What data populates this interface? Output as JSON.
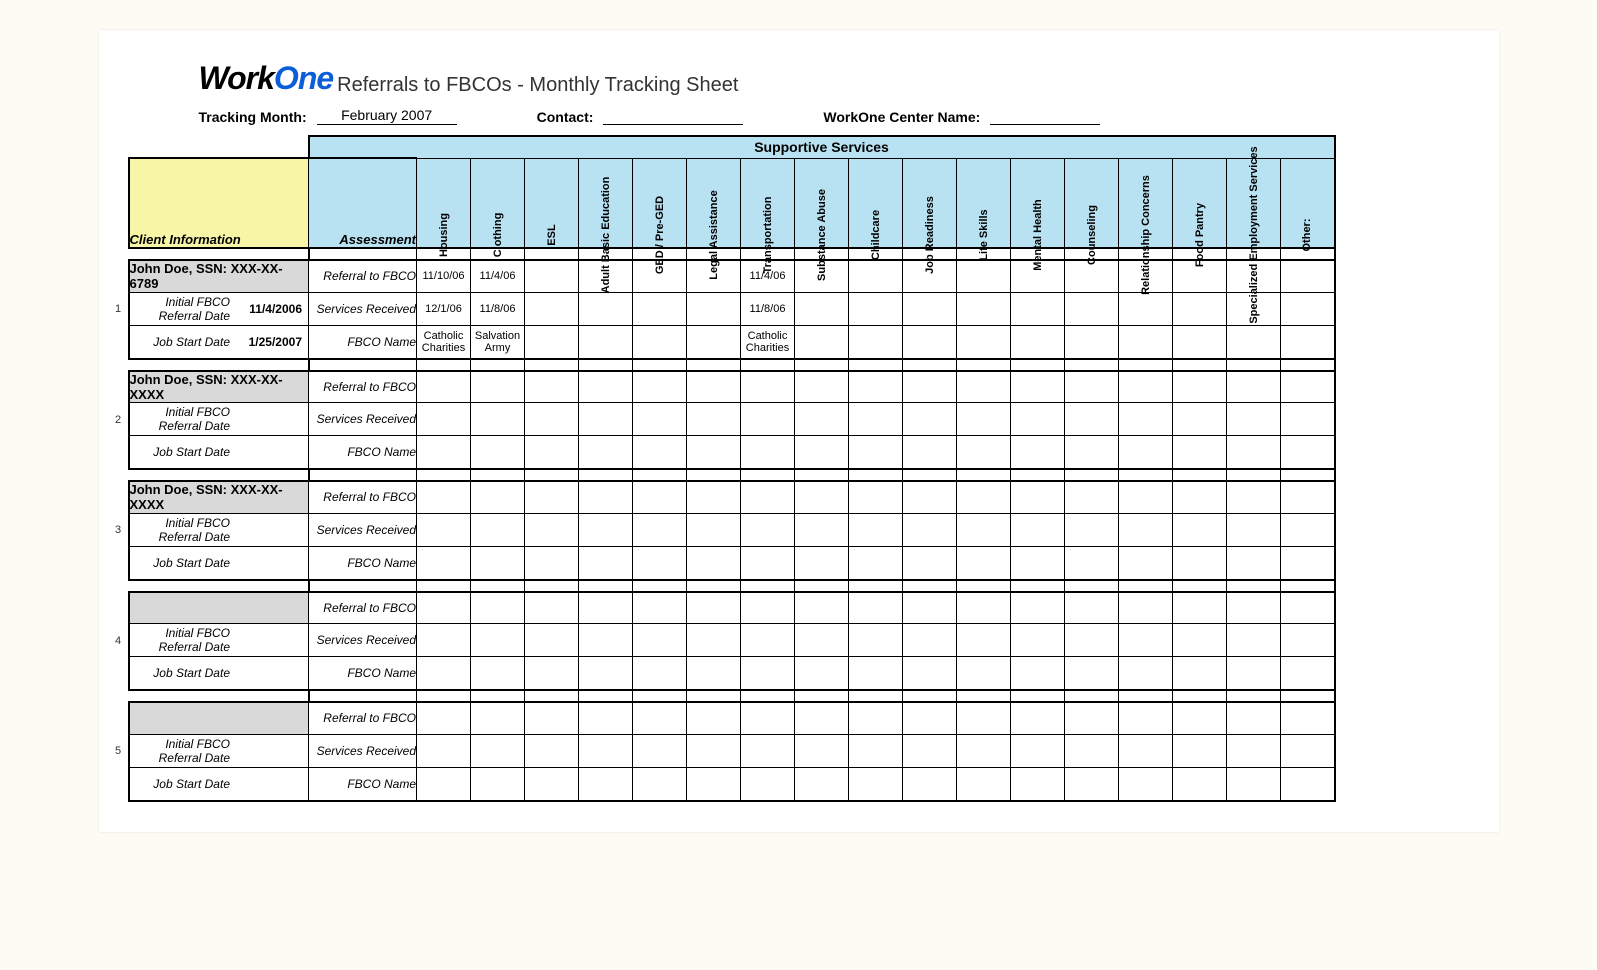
{
  "logo": {
    "part1": "Work",
    "part2": "One"
  },
  "title": "Referrals to FBCOs - Monthly Tracking Sheet",
  "meta": {
    "tracking_month_label": "Tracking Month:",
    "tracking_month_value": "February 2007",
    "contact_label": "Contact:",
    "contact_value": "",
    "center_label": "WorkOne Center Name:",
    "center_value": ""
  },
  "headers": {
    "supportive_services": "Supportive Services",
    "client_information": "Client Information",
    "assessment": "Assessment",
    "services": [
      "Housing",
      "Clothing",
      "ESL",
      "Adult Basic Education",
      "GED / Pre-GED",
      "Legal Assistance",
      "Transportation",
      "Substance Abuse",
      "Childcare",
      "Job Readiness",
      "Life Skills",
      "Mental Health",
      "Counseling",
      "Relationship Concerns",
      "Food Pantry",
      "Specialized Employment Services",
      "Other:"
    ]
  },
  "row_labels": {
    "referral": "Referral to FBCO",
    "received": "Services Received",
    "fbco": "FBCO Name",
    "initial": "Initial FBCO Referral Date",
    "jobstart": "Job Start Date"
  },
  "clients": [
    {
      "num": "1",
      "name": "John Doe, SSN: XXX-XX-6789",
      "initial_date": "11/4/2006",
      "jobstart_date": "1/25/2007",
      "rows": [
        {
          "cells": [
            "11/10/06",
            "11/4/06",
            "",
            "",
            "",
            "",
            "11/4/06",
            "",
            "",
            "",
            "",
            "",
            "",
            "",
            "",
            "",
            ""
          ]
        },
        {
          "cells": [
            "12/1/06",
            "11/8/06",
            "",
            "",
            "",
            "",
            "11/8/06",
            "",
            "",
            "",
            "",
            "",
            "",
            "",
            "",
            "",
            ""
          ]
        },
        {
          "cells": [
            "Catholic Charities",
            "Salvation Army",
            "",
            "",
            "",
            "",
            "Catholic Charities",
            "",
            "",
            "",
            "",
            "",
            "",
            "",
            "",
            "",
            ""
          ]
        }
      ]
    },
    {
      "num": "2",
      "name": "John Doe, SSN: XXX-XX-XXXX",
      "initial_date": "",
      "jobstart_date": "",
      "rows": [
        {
          "cells": [
            "",
            "",
            "",
            "",
            "",
            "",
            "",
            "",
            "",
            "",
            "",
            "",
            "",
            "",
            "",
            "",
            ""
          ]
        },
        {
          "cells": [
            "",
            "",
            "",
            "",
            "",
            "",
            "",
            "",
            "",
            "",
            "",
            "",
            "",
            "",
            "",
            "",
            ""
          ]
        },
        {
          "cells": [
            "",
            "",
            "",
            "",
            "",
            "",
            "",
            "",
            "",
            "",
            "",
            "",
            "",
            "",
            "",
            "",
            ""
          ]
        }
      ]
    },
    {
      "num": "3",
      "name": "John Doe, SSN: XXX-XX-XXXX",
      "initial_date": "",
      "jobstart_date": "",
      "rows": [
        {
          "cells": [
            "",
            "",
            "",
            "",
            "",
            "",
            "",
            "",
            "",
            "",
            "",
            "",
            "",
            "",
            "",
            "",
            ""
          ]
        },
        {
          "cells": [
            "",
            "",
            "",
            "",
            "",
            "",
            "",
            "",
            "",
            "",
            "",
            "",
            "",
            "",
            "",
            "",
            ""
          ]
        },
        {
          "cells": [
            "",
            "",
            "",
            "",
            "",
            "",
            "",
            "",
            "",
            "",
            "",
            "",
            "",
            "",
            "",
            "",
            ""
          ]
        }
      ]
    },
    {
      "num": "4",
      "name": "",
      "initial_date": "",
      "jobstart_date": "",
      "rows": [
        {
          "cells": [
            "",
            "",
            "",
            "",
            "",
            "",
            "",
            "",
            "",
            "",
            "",
            "",
            "",
            "",
            "",
            "",
            ""
          ]
        },
        {
          "cells": [
            "",
            "",
            "",
            "",
            "",
            "",
            "",
            "",
            "",
            "",
            "",
            "",
            "",
            "",
            "",
            "",
            ""
          ]
        },
        {
          "cells": [
            "",
            "",
            "",
            "",
            "",
            "",
            "",
            "",
            "",
            "",
            "",
            "",
            "",
            "",
            "",
            "",
            ""
          ]
        }
      ]
    },
    {
      "num": "5",
      "name": "",
      "initial_date": "",
      "jobstart_date": "",
      "rows": [
        {
          "cells": [
            "",
            "",
            "",
            "",
            "",
            "",
            "",
            "",
            "",
            "",
            "",
            "",
            "",
            "",
            "",
            "",
            ""
          ]
        },
        {
          "cells": [
            "",
            "",
            "",
            "",
            "",
            "",
            "",
            "",
            "",
            "",
            "",
            "",
            "",
            "",
            "",
            "",
            ""
          ]
        },
        {
          "cells": [
            "",
            "",
            "",
            "",
            "",
            "",
            "",
            "",
            "",
            "",
            "",
            "",
            "",
            "",
            "",
            "",
            ""
          ]
        }
      ]
    }
  ]
}
